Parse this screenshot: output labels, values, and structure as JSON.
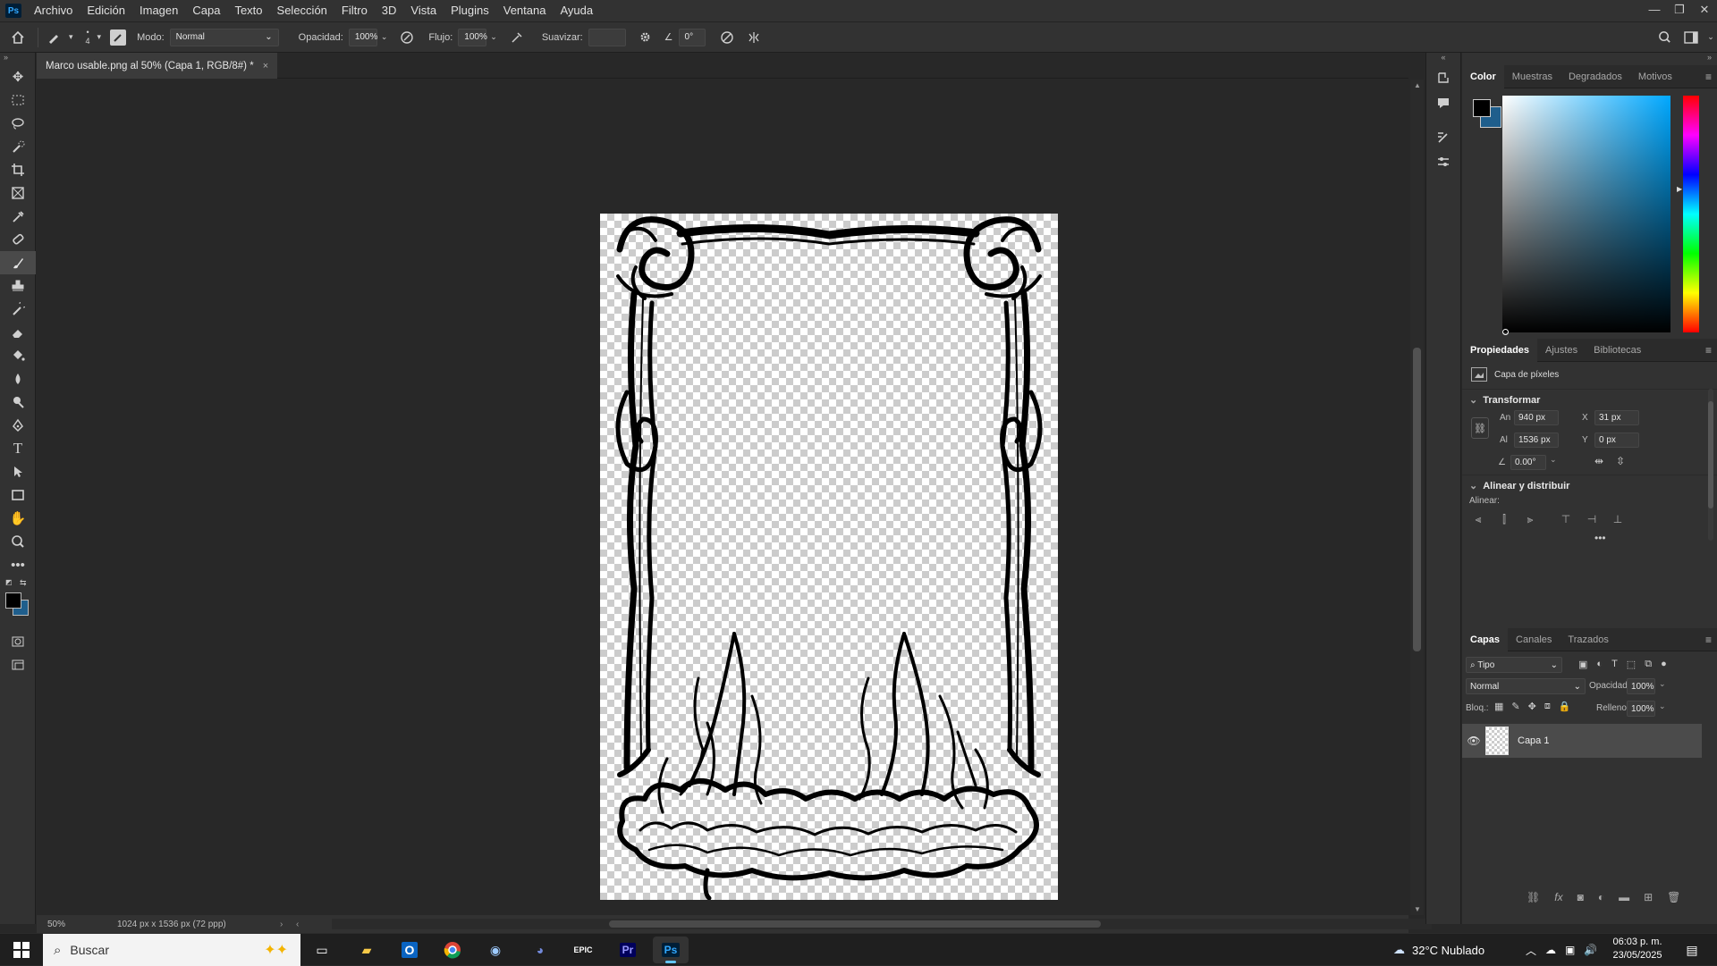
{
  "app": {
    "logo_text": "Ps"
  },
  "menu": [
    "Archivo",
    "Edición",
    "Imagen",
    "Capa",
    "Texto",
    "Selección",
    "Filtro",
    "3D",
    "Vista",
    "Plugins",
    "Ventana",
    "Ayuda"
  ],
  "window_controls": {
    "minimize": "—",
    "restore": "❐",
    "close": "✕"
  },
  "options_bar": {
    "brush_size": "4",
    "mode_label": "Modo:",
    "mode_value": "Normal",
    "opacity_label": "Opacidad:",
    "opacity_value": "100%",
    "flow_label": "Flujo:",
    "flow_value": "100%",
    "smooth_label": "Suavizar:",
    "smooth_value": "",
    "angle_value": "0°"
  },
  "document": {
    "tab_title": "Marco usable.png al 50% (Capa 1, RGB/8#) *",
    "zoom": "50%",
    "doc_info": "1024 px x 1536 px (72 ppp)"
  },
  "tools": [
    "move",
    "marquee",
    "lasso",
    "quick-select",
    "crop",
    "frame",
    "eyedropper",
    "healing",
    "brush",
    "stamp",
    "history-brush",
    "eraser",
    "paint-bucket",
    "blur",
    "dodge",
    "pen",
    "type",
    "path-select",
    "rectangle",
    "hand",
    "zoom",
    "more"
  ],
  "color_panel": {
    "tabs": [
      "Color",
      "Muestras",
      "Degradados",
      "Motivos"
    ],
    "active_tab": "Color",
    "foreground": "#000000",
    "background": "#1f5e8c"
  },
  "properties_panel": {
    "tabs": [
      "Propiedades",
      "Ajustes",
      "Bibliotecas"
    ],
    "active_tab": "Propiedades",
    "layer_kind": "Capa de píxeles",
    "transform_title": "Transformar",
    "w_label": "An",
    "w_value": "940 px",
    "h_label": "Al",
    "h_value": "1536 px",
    "x_label": "X",
    "x_value": "31 px",
    "y_label": "Y",
    "y_value": "0 px",
    "angle_value": "0.00°",
    "align_title": "Alinear y distribuir",
    "align_label": "Alinear:"
  },
  "layers_panel": {
    "tabs": [
      "Capas",
      "Canales",
      "Trazados"
    ],
    "active_tab": "Capas",
    "filter_label": "Tipo",
    "blend_mode": "Normal",
    "opacity_label": "Opacidad:",
    "opacity_value": "100%",
    "lock_label": "Bloq.:",
    "fill_label": "Relleno:",
    "fill_value": "100%",
    "layers": [
      {
        "name": "Capa 1",
        "visible": true
      }
    ]
  },
  "taskbar": {
    "search_placeholder": "Buscar",
    "weather": "32°C  Nublado",
    "time": "06:03 p. m.",
    "date": "23/05/2025",
    "apps": [
      "task-view",
      "file-explorer",
      "outlook",
      "chrome",
      "steam",
      "discord",
      "epic-games",
      "premiere",
      "photoshop"
    ]
  }
}
